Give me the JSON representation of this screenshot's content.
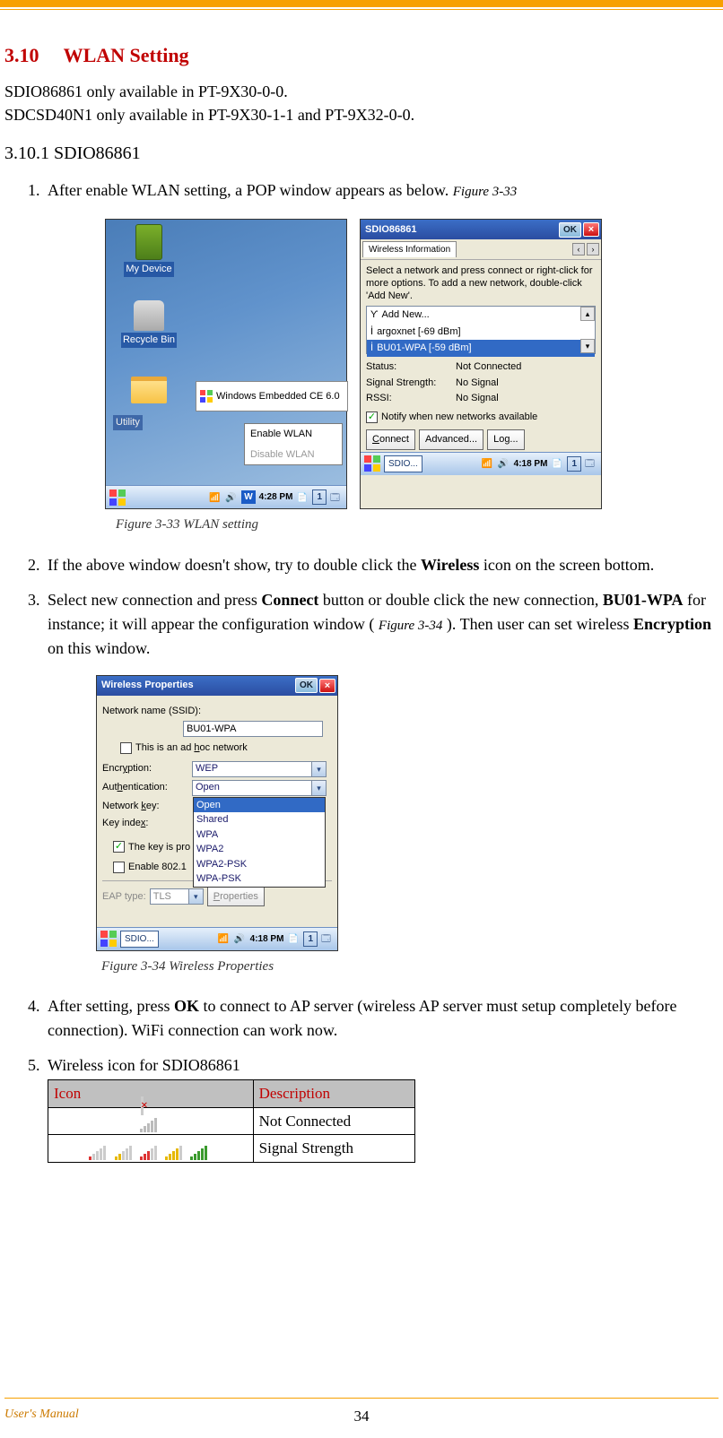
{
  "section": {
    "num": "3.10",
    "title": "WLAN Setting"
  },
  "avail": {
    "line1": "SDIO86861 only available in PT-9X30-0-0.",
    "line2": "SDCSD40N1 only available in PT-9X30-1-1 and PT-9X32-0-0."
  },
  "subsection": "3.10.1 SDIO86861",
  "steps": {
    "s1a": "After enable WLAN setting, a POP window appears as below. ",
    "s1ref": "Figure 3-33",
    "s2a": "If the above window doesn't show, try to double click the ",
    "s2b": "Wireless",
    "s2c": " icon on the screen bottom.",
    "s3a": "Select new connection and press ",
    "s3b": "Connect",
    "s3c": " button or double click the new connection, ",
    "s3d": "BU01-WPA",
    "s3e": " for instance; it will appear the  configuration window (",
    "s3ref": "Figure 3-34",
    "s3f": "). Then user can set wireless ",
    "s3g": "Encryption",
    "s3h": " on this window.",
    "s4a": "After setting, press ",
    "s4b": "OK",
    "s4c": " to connect to AP server (wireless AP server must setup completely before connection). WiFi connection can work now.",
    "s5": "Wireless icon for SDIO86861"
  },
  "captions": {
    "fig33": "Figure 3-33 WLAN setting",
    "fig34": "Figure 3-34 Wireless Properties"
  },
  "desktop": {
    "icon1": "My Device",
    "icon2": "Recycle Bin",
    "icon3": "Utility",
    "ce_logo": "Windows Embedded CE 6.0",
    "menu_enable": "Enable WLAN",
    "menu_disable": "Disable WLAN",
    "time": "4:28 PM",
    "tray_num": "1"
  },
  "wlan_dialog": {
    "title": "SDIO86861",
    "ok": "OK",
    "tab": "Wireless Information",
    "helper": "Select a network and press connect or right-click for more options.  To add a new network, double-click 'Add New'.",
    "list": {
      "add": "Add New...",
      "net1": "argoxnet [-69 dBm]",
      "net2": "BU01-WPA [-59 dBm]"
    },
    "status_lbl": "Status:",
    "status_val": "Not Connected",
    "sig_lbl": "Signal Strength:",
    "sig_val": "No Signal",
    "rssi_lbl": "RSSI:",
    "rssi_val": "No Signal",
    "notify": "Notify when new networks available",
    "btn_connect": "Connect",
    "btn_adv": "Advanced...",
    "btn_log": "Log...",
    "task_label": "SDIO...",
    "time": "4:18 PM",
    "tray_num": "1"
  },
  "props_dialog": {
    "title": "Wireless Properties",
    "ok": "OK",
    "ssid_label": "Network name (SSID):",
    "ssid_value": "BU01-WPA",
    "adhoc": "This is an ad hoc network",
    "enc_label": "Encryption:",
    "enc_value": "WEP",
    "auth_label": "Authentication:",
    "auth_value": "Open",
    "auth_options": [
      "Open",
      "Shared",
      "WPA",
      "WPA2",
      "WPA2-PSK",
      "WPA-PSK"
    ],
    "key_label": "Network key:",
    "idx_label": "Key index:",
    "key_auto": "The key is pro",
    "enable_8021x": "Enable 802.1",
    "eap_label": "EAP type:",
    "eap_value": "TLS",
    "btn_props": "Properties",
    "task_label": "SDIO...",
    "time": "4:18 PM",
    "tray_num": "1"
  },
  "icon_table": {
    "h1": "Icon",
    "h2": "Description",
    "r1": "Not Connected",
    "r2": "Signal Strength"
  },
  "footer": {
    "label": "User's Manual",
    "page": "34"
  }
}
